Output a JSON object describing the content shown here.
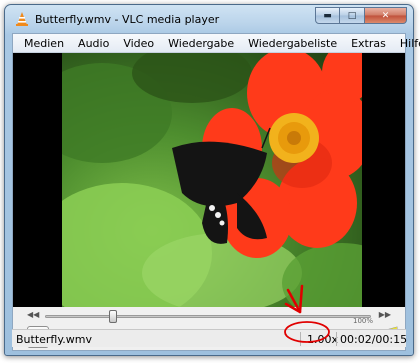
{
  "window": {
    "title": "Butterfly.wmv - VLC media player",
    "caption_buttons": {
      "minimize_icon": "minimize-icon",
      "maximize_icon": "maximize-icon",
      "close_icon": "close-icon"
    }
  },
  "menu": {
    "items": [
      "Medien",
      "Audio",
      "Video",
      "Wiedergabe",
      "Wiedergabeliste",
      "Extras",
      "Hilfe"
    ]
  },
  "video": {
    "content": "butterfly-on-flower-video-frame"
  },
  "seek": {
    "position_fraction": 0.21
  },
  "volume": {
    "percent_label": "100%",
    "level": 1.0
  },
  "status": {
    "file": "Butterfly.wmv",
    "speed": "1.00x",
    "time": "00:02/00:15"
  },
  "colors": {
    "annotation": "#e00000",
    "video_bg": "#000000"
  }
}
